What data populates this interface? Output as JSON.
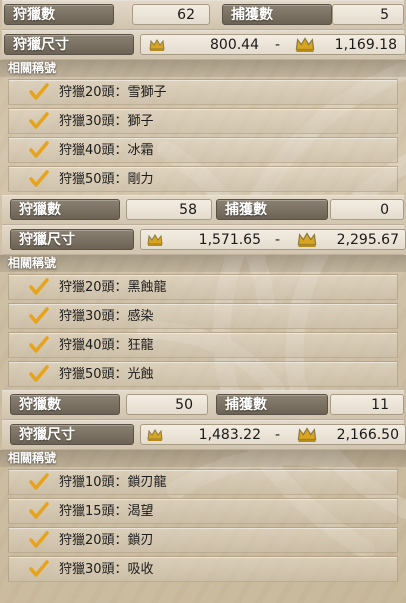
{
  "colors": {
    "label_bg": "#756b5d",
    "value_bg": "#ece5d8",
    "check": "#e7a31b",
    "crown_gold": "#d9a520",
    "crown_outline": "#8a7a45"
  },
  "icons": {
    "crown_small": "crown-icon-small",
    "crown_large": "crown-icon-large",
    "check": "check-icon"
  },
  "monsters": [
    {
      "hunt_label": "狩獵數",
      "hunt_count": "62",
      "capture_label": "捕獲數",
      "capture_count": "5",
      "size_label": "狩獵尺寸",
      "size_min": "800.44",
      "size_sep": "-",
      "size_max": "1,169.18",
      "titles_header": "相關稱號",
      "titles": [
        {
          "text": "狩獵20頭：雪獅子"
        },
        {
          "text": "狩獵30頭：獅子"
        },
        {
          "text": "狩獵40頭：冰霜"
        },
        {
          "text": "狩獵50頭：剛力"
        }
      ]
    },
    {
      "hunt_label": "狩獵數",
      "hunt_count": "58",
      "capture_label": "捕獲數",
      "capture_count": "0",
      "size_label": "狩獵尺寸",
      "size_min": "1,571.65",
      "size_sep": "-",
      "size_max": "2,295.67",
      "titles_header": "相關稱號",
      "titles": [
        {
          "text": "狩獵20頭：黑蝕龍"
        },
        {
          "text": "狩獵30頭：感染"
        },
        {
          "text": "狩獵40頭：狂龍"
        },
        {
          "text": "狩獵50頭：光蝕"
        }
      ]
    },
    {
      "hunt_label": "狩獵數",
      "hunt_count": "50",
      "capture_label": "捕獲數",
      "capture_count": "11",
      "size_label": "狩獵尺寸",
      "size_min": "1,483.22",
      "size_sep": "-",
      "size_max": "2,166.50",
      "titles_header": "相關稱號",
      "titles": [
        {
          "text": "狩獵10頭：鎖刃龍"
        },
        {
          "text": "狩獵15頭：渴望"
        },
        {
          "text": "狩獵20頭：鎖刃"
        },
        {
          "text": "狩獵30頭：吸收"
        }
      ]
    }
  ]
}
